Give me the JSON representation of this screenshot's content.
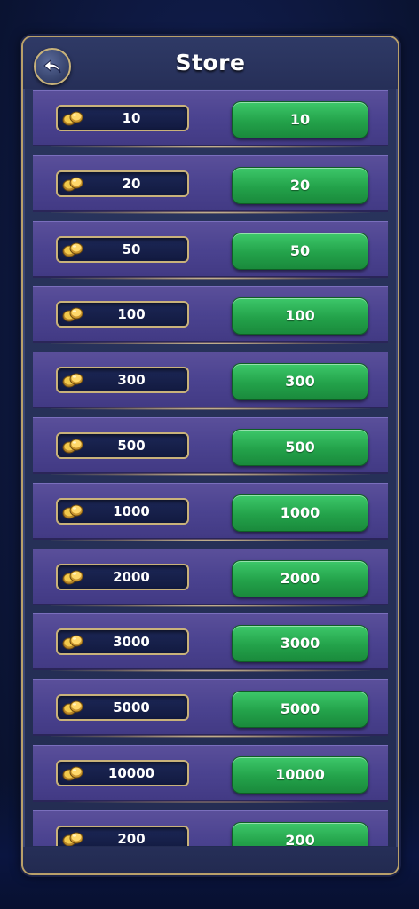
{
  "header": {
    "title": "Store"
  },
  "items": [
    {
      "amount": "10",
      "price": "10"
    },
    {
      "amount": "20",
      "price": "20"
    },
    {
      "amount": "50",
      "price": "50"
    },
    {
      "amount": "100",
      "price": "100"
    },
    {
      "amount": "300",
      "price": "300"
    },
    {
      "amount": "500",
      "price": "500"
    },
    {
      "amount": "1000",
      "price": "1000"
    },
    {
      "amount": "2000",
      "price": "2000"
    },
    {
      "amount": "3000",
      "price": "3000"
    },
    {
      "amount": "5000",
      "price": "5000"
    },
    {
      "amount": "10000",
      "price": "10000"
    },
    {
      "amount": "200",
      "price": "200"
    }
  ],
  "colors": {
    "buy_button": "#23a24a",
    "frame_border": "#b9a06a",
    "row": "#4b4390"
  },
  "icons": {
    "back": "back-arrow-icon",
    "coin": "gold-coins-icon"
  }
}
